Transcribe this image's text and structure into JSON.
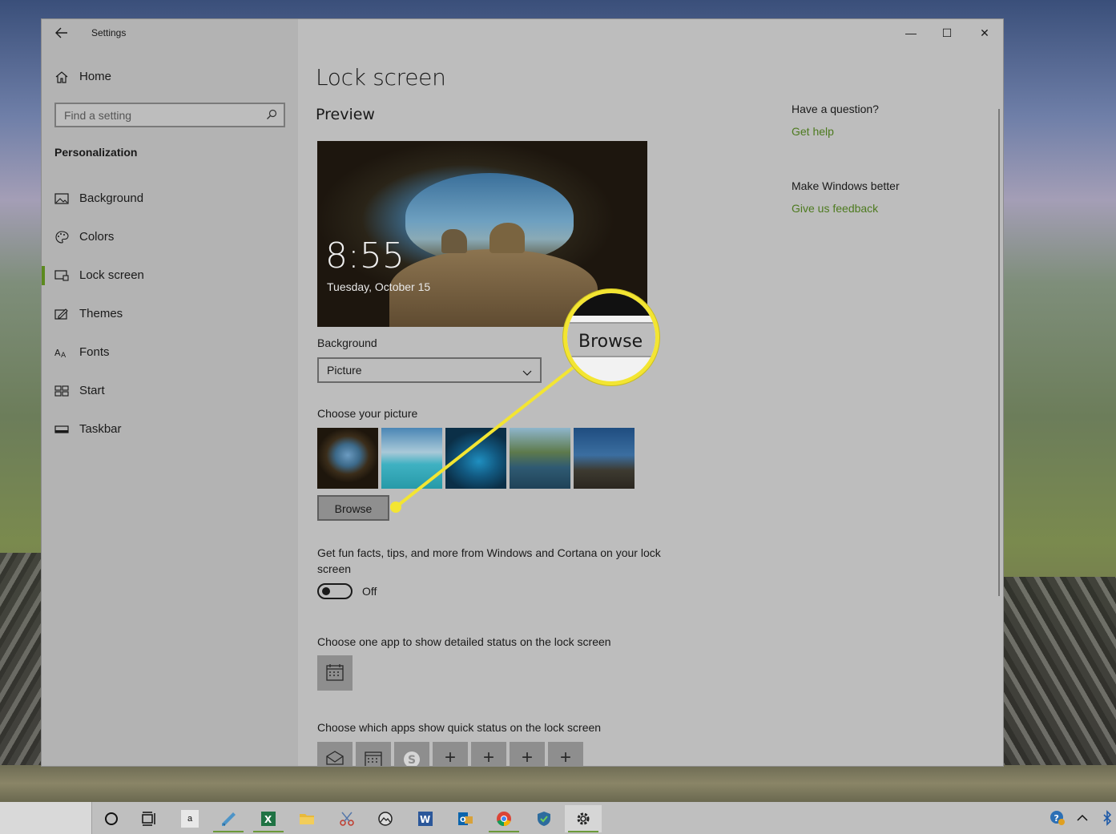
{
  "window": {
    "title": "Settings",
    "controls": {
      "minimize": "—",
      "maximize": "☐",
      "close": "✕"
    }
  },
  "sidebar": {
    "home_label": "Home",
    "search_placeholder": "Find a setting",
    "section": "Personalization",
    "items": [
      {
        "label": "Background",
        "icon": "picture-icon"
      },
      {
        "label": "Colors",
        "icon": "palette-icon"
      },
      {
        "label": "Lock screen",
        "icon": "lock-screen-icon",
        "active": true
      },
      {
        "label": "Themes",
        "icon": "themes-icon"
      },
      {
        "label": "Fonts",
        "icon": "fonts-icon"
      },
      {
        "label": "Start",
        "icon": "start-icon"
      },
      {
        "label": "Taskbar",
        "icon": "taskbar-icon"
      }
    ]
  },
  "main": {
    "title": "Lock screen",
    "preview_heading": "Preview",
    "preview_time": "8:55",
    "preview_date": "Tuesday, October 15",
    "background_label": "Background",
    "background_value": "Picture",
    "choose_picture_label": "Choose your picture",
    "browse_label": "Browse",
    "fun_facts_label": "Get fun facts, tips, and more from Windows and Cortana on your lock screen",
    "toggle_state": "Off",
    "detailed_status_label": "Choose one app to show detailed status on the lock screen",
    "quick_status_label": "Choose which apps show quick status on the lock screen"
  },
  "aside": {
    "question_title": "Have a question?",
    "get_help": "Get help",
    "better_title": "Make Windows better",
    "feedback": "Give us feedback"
  },
  "callout": {
    "text": "Browse"
  },
  "colors": {
    "accent_link": "#4d7a1f",
    "active_indicator": "#5c8a1f",
    "callout": "#f3e532"
  },
  "taskbar": {
    "amazon_label": "a"
  }
}
